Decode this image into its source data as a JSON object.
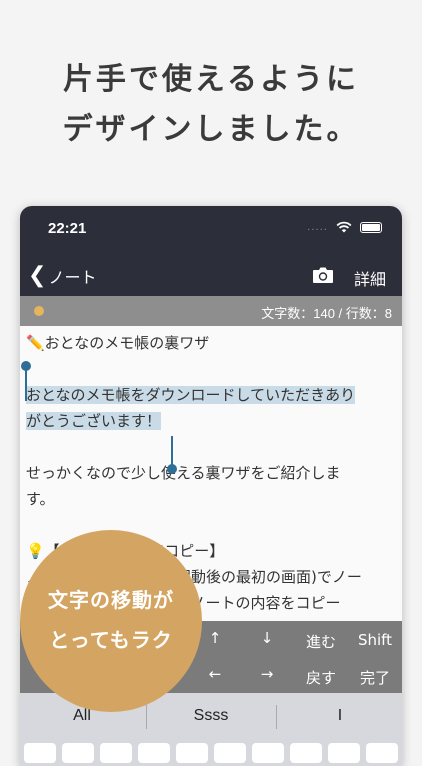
{
  "headline": {
    "line1": "片手で使えるように",
    "line2": "デザインしました。"
  },
  "status": {
    "time": "22:21",
    "signal_dots": "....."
  },
  "nav": {
    "back_label": "ノート",
    "detail_label": "詳細",
    "icons": [
      "chevron-left-icon",
      "camera-icon"
    ]
  },
  "info": {
    "counts": "文字数：140 / 行数：8"
  },
  "editor": {
    "line1": "✏️おとなのメモ帳の裏ワザ",
    "line2": "",
    "line3": "おとなのメモ帳をダウンロードしていただきあり",
    "line4": "がとうございます！",
    "line5": "",
    "line6": "せっかくなので少し使える裏ワザをご紹介しま",
    "line7": "す。",
    "line8": "",
    "line9": "💡【ノ　　　押しでコピー】",
    "line10": "ノ　　　　　　　　リ起動後の最初の画面)でノー",
    "line11": "　　　　　　　　とそのノートの内容をコピー"
  },
  "toolbar": {
    "up": "↑",
    "down": "↓",
    "forward": "進む",
    "shift": "Shift",
    "left": "←",
    "right": "→",
    "back": "戻す",
    "done": "完了"
  },
  "suggestions": [
    "All",
    "Ssss",
    "I"
  ],
  "bubble": {
    "line1": "文字の移動が",
    "line2": "とってもラク"
  },
  "colors": {
    "bar": "#2c2f3a",
    "accent": "#d4a562",
    "selection": "#c9dbe6",
    "handle": "#2f6f95"
  }
}
